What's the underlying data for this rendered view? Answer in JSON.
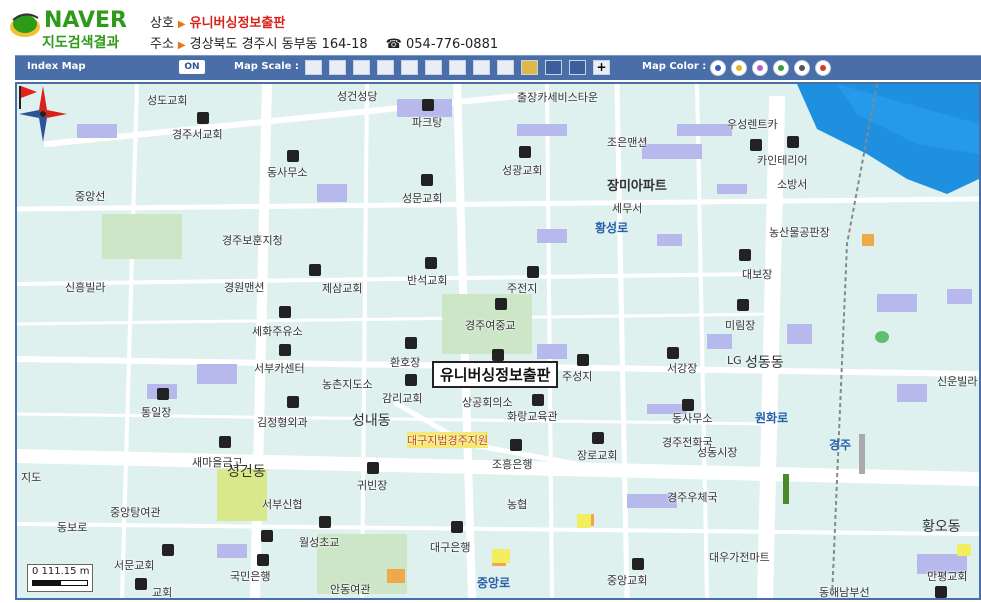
{
  "logo": {
    "brand": "NAVER",
    "subtitle": "지도검색결과"
  },
  "business": {
    "name_label": "상호",
    "name": "유니버싱정보출판",
    "address_label": "주소",
    "address": "경상북도 경주시 동부동 164-18",
    "phone_icon": "telephone-icon",
    "phone": "054-776-0881"
  },
  "toolbar": {
    "index_map_label": "Index Map",
    "index_map_state": "ON",
    "scale_label": "Map  Scale  :",
    "color_label": "Map Color  :",
    "colors": [
      "#2f5db8",
      "#e8b221",
      "#b55cd4",
      "#3a9c3a",
      "#555555",
      "#d83a2a"
    ]
  },
  "map": {
    "target_label": "유니버싱정보출판",
    "scale_text": "0    111.15 m",
    "labels": [
      {
        "t": "성도교회"
      },
      {
        "t": "성건성당"
      },
      {
        "t": "출장카세비스타운"
      },
      {
        "t": "파크탕"
      },
      {
        "t": "경주서교회"
      },
      {
        "t": "우성렌트카"
      },
      {
        "t": "조은맨션"
      },
      {
        "t": "성광교회"
      },
      {
        "t": "동사무소"
      },
      {
        "t": "카인테리어"
      },
      {
        "t": "중앙선"
      },
      {
        "t": "성문교회"
      },
      {
        "t": "소방서"
      },
      {
        "t": "세무서"
      },
      {
        "t": "경주보훈지청"
      },
      {
        "t": "농산물공판장"
      },
      {
        "t": "반석교회"
      },
      {
        "t": "대보장"
      },
      {
        "t": "신흥빌라"
      },
      {
        "t": "경원맨션"
      },
      {
        "t": "제삼교회"
      },
      {
        "t": "주전지"
      },
      {
        "t": "미림장"
      },
      {
        "t": "세화주유소"
      },
      {
        "t": "경주여중교"
      },
      {
        "t": "환호장"
      },
      {
        "t": "서부카센터"
      },
      {
        "t": "서강장"
      },
      {
        "t": "LG"
      },
      {
        "t": "신운빌라"
      },
      {
        "t": "농촌지도소"
      },
      {
        "t": "감리교회"
      },
      {
        "t": "주성지"
      },
      {
        "t": "통일장"
      },
      {
        "t": "상공회의소"
      },
      {
        "t": "화랑교육관"
      },
      {
        "t": "김정형외과"
      },
      {
        "t": "동사무소"
      },
      {
        "t": "대구지법경주지원"
      },
      {
        "t": "경주전화국"
      },
      {
        "t": "새마을금고"
      },
      {
        "t": "조흥은행"
      },
      {
        "t": "장로교회"
      },
      {
        "t": "성동시장"
      },
      {
        "t": "지도"
      },
      {
        "t": "귀빈장"
      },
      {
        "t": "서부신협"
      },
      {
        "t": "농협"
      },
      {
        "t": "경주우체국"
      },
      {
        "t": "중앙탕여관"
      },
      {
        "t": "동보로"
      },
      {
        "t": "월성초교"
      },
      {
        "t": "대구은행"
      },
      {
        "t": "대우가전마트"
      },
      {
        "t": "서문교회"
      },
      {
        "t": "국민은행"
      },
      {
        "t": "중앙교회"
      },
      {
        "t": "만평교회"
      },
      {
        "t": "안동여관"
      },
      {
        "t": "동해남부선"
      },
      {
        "t": "교회"
      },
      {
        "t": "장미아파트"
      }
    ],
    "roads": [
      "황성로",
      "원화로",
      "중앙로",
      "경주"
    ],
    "districts": [
      "성동동",
      "성내동",
      "성건동",
      "황오동"
    ]
  }
}
